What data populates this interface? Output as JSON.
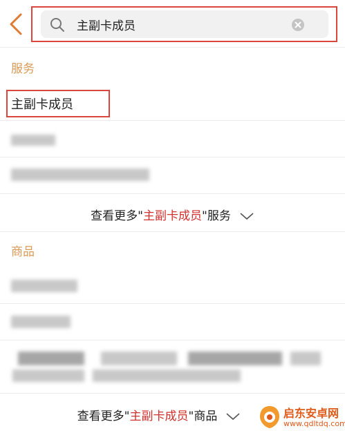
{
  "search": {
    "query": "主副卡成员"
  },
  "services": {
    "section_title": "服务",
    "first_result": "主副卡成员",
    "more_prefix": "查看更多\"",
    "more_keyword": "主副卡成员",
    "more_suffix": "\"服务"
  },
  "goods": {
    "section_title": "商品",
    "more_prefix": "查看更多\"",
    "more_keyword": "主副卡成员",
    "more_suffix": "\"商品"
  },
  "watermark": {
    "title": "启东安卓网",
    "url": "www.qdltdq.com"
  },
  "colors": {
    "accent": "#d9463e",
    "section": "#d99a55",
    "keyword": "#d0312d"
  },
  "icons": [
    "back-arrow-icon",
    "search-icon",
    "clear-icon",
    "chevron-down-icon"
  ]
}
